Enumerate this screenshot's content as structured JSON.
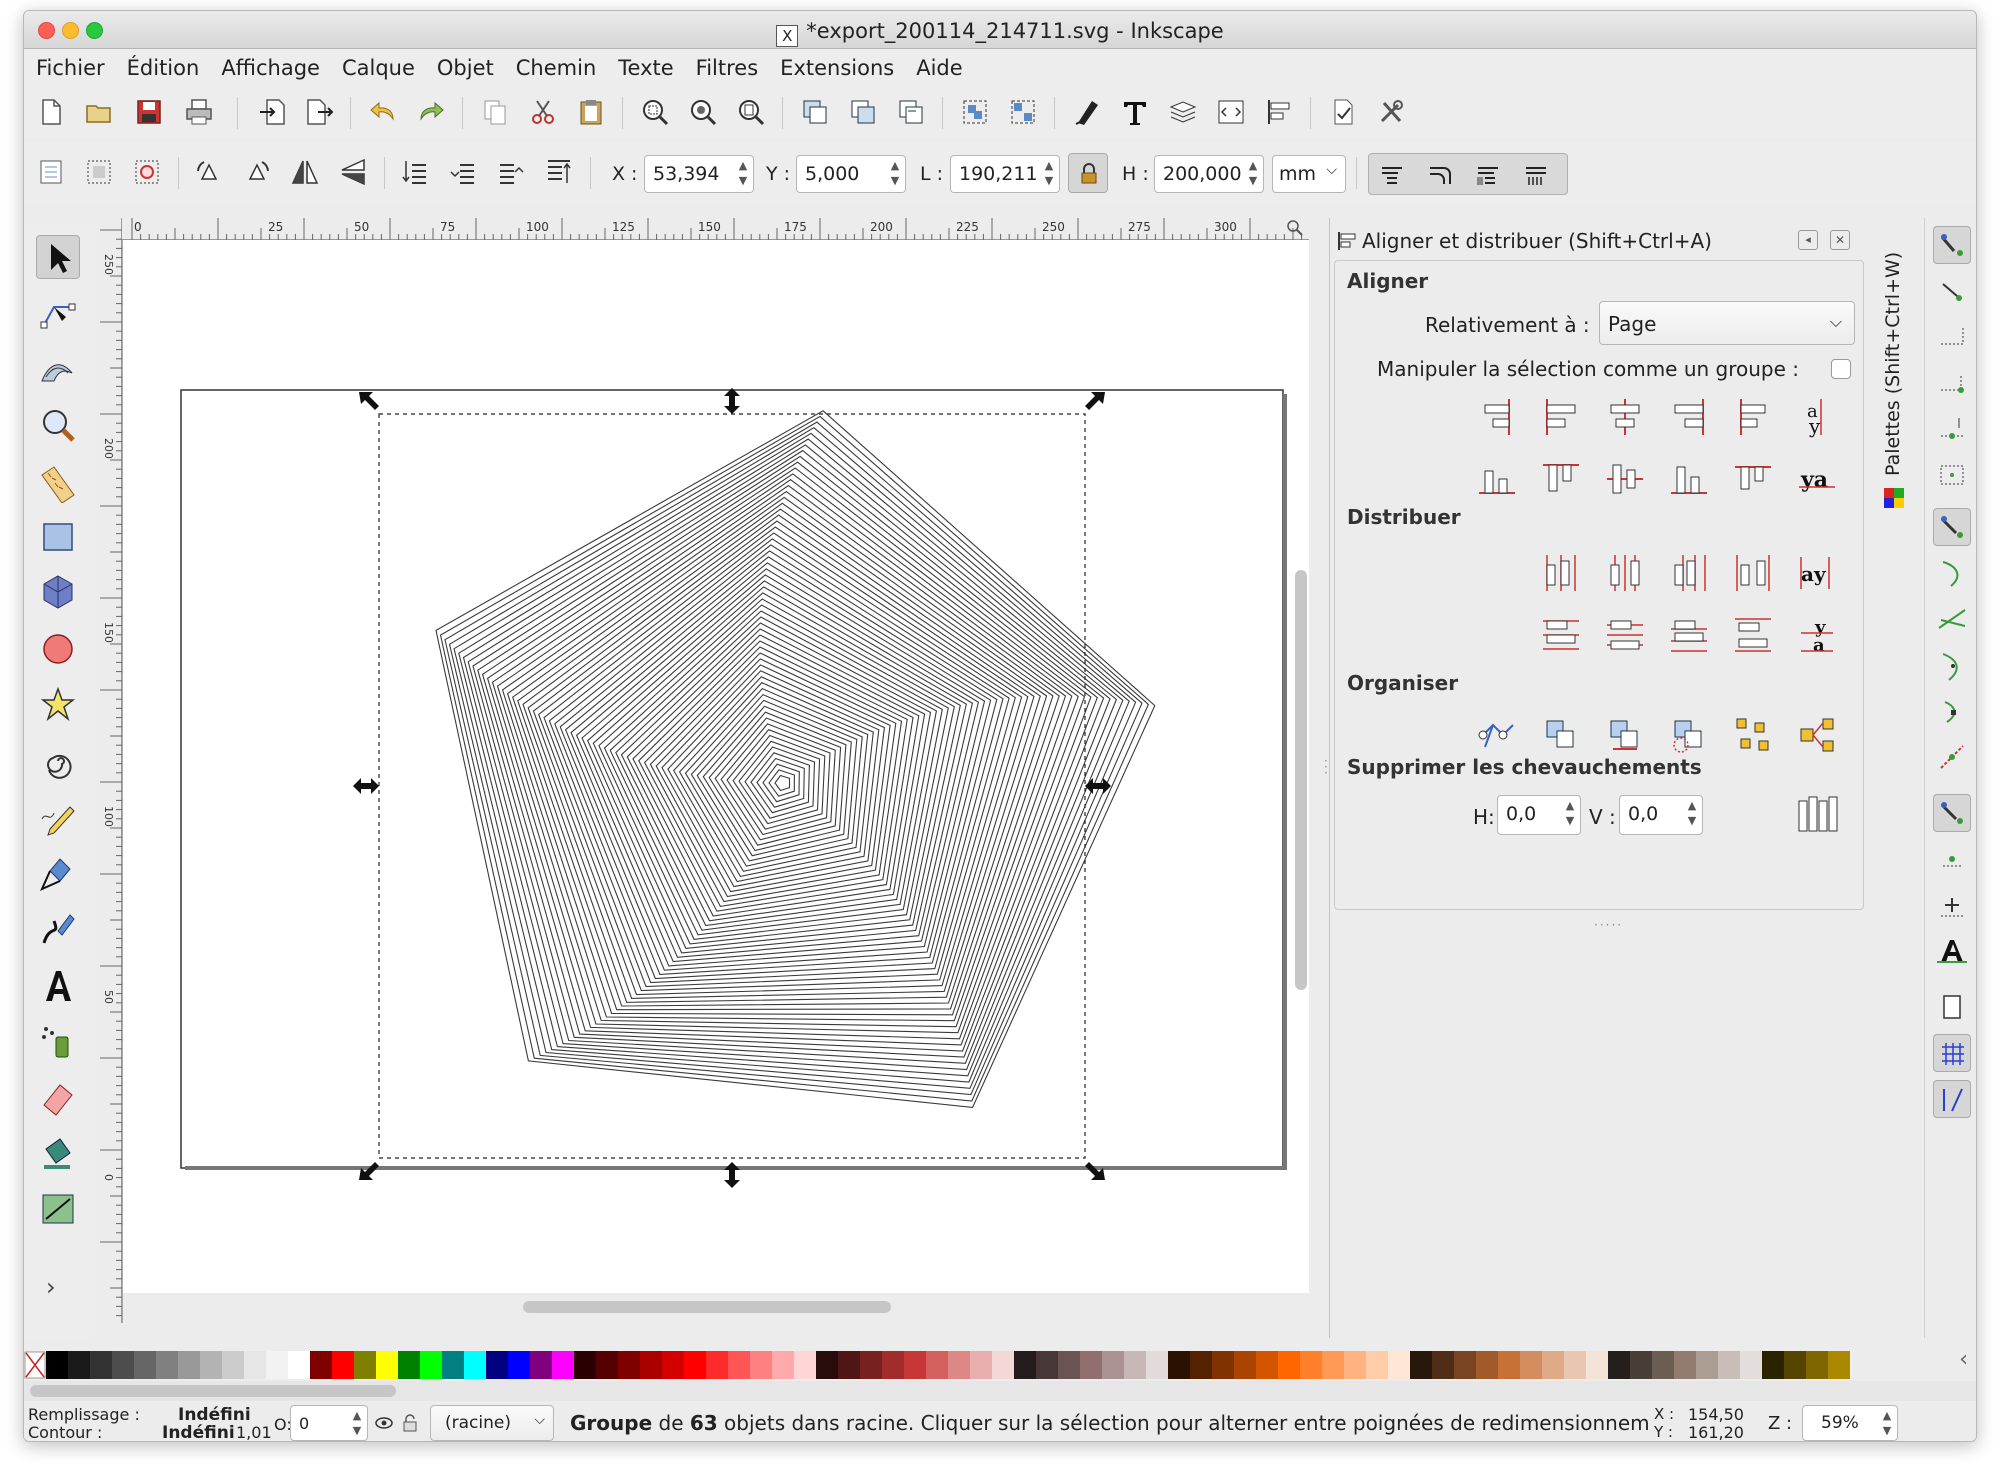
{
  "window": {
    "title": "*export_200114_214711.svg - Inkscape",
    "x11_glyph": "X"
  },
  "menu": [
    "Fichier",
    "Édition",
    "Affichage",
    "Calque",
    "Objet",
    "Chemin",
    "Texte",
    "Filtres",
    "Extensions",
    "Aide"
  ],
  "controls": {
    "x_label": "X :",
    "x_value": "53,394",
    "y_label": "Y :",
    "y_value": "5,000",
    "w_label": "L :",
    "w_value": "190,211",
    "h_label": "H :",
    "h_value": "200,000",
    "unit": "mm"
  },
  "ruler": {
    "h_ticks": [
      "0",
      "25",
      "50",
      "75",
      "100",
      "125",
      "150",
      "175",
      "200",
      "225",
      "250",
      "275",
      "300"
    ],
    "v_ticks": [
      "250",
      "200",
      "150",
      "100",
      "50",
      "0"
    ]
  },
  "align_panel": {
    "title": "Aligner et distribuer (Shift+Ctrl+A)",
    "section_align": "Aligner",
    "relative_label": "Relativement à :",
    "relative_value": "Page",
    "group_label": "Manipuler la sélection comme un groupe :",
    "section_distribute": "Distribuer",
    "section_arrange": "Organiser",
    "section_overlap": "Supprimer les chevauchements",
    "h_label": "H:",
    "h_value": "0,0",
    "v_label": "V :",
    "v_value": "0,0"
  },
  "palettes_tab": "Palettes (Shift+Ctrl+W)",
  "status": {
    "fill_label": "Remplissage :",
    "fill_value": "Indéfini",
    "stroke_label": "Contour :",
    "stroke_value": "Indéfini",
    "stroke_width": "1,01",
    "opacity_label": "O:",
    "opacity_value": "0",
    "layer": "(racine)",
    "message_prefix": "Groupe",
    "message_mid": " de ",
    "message_count": "63",
    "message_rest": " objets dans racine. Cliquer sur la sélection pour alterner entre poignées de redimensionnem",
    "x_label": "X :",
    "x_coord": "154,50",
    "y_label": "Y :",
    "y_coord": "161,20",
    "zoom_label": "Z :",
    "zoom": "59%"
  },
  "palette_colors": [
    "#000000",
    "#1a1a1a",
    "#333333",
    "#4d4d4d",
    "#666666",
    "#808080",
    "#999999",
    "#b3b3b3",
    "#cccccc",
    "#e6e6e6",
    "#f2f2f2",
    "#ffffff",
    "#800000",
    "#ff0000",
    "#808000",
    "#ffff00",
    "#008000",
    "#00ff00",
    "#008080",
    "#00ffff",
    "#000080",
    "#0000ff",
    "#800080",
    "#ff00ff",
    "#2b0000",
    "#550000",
    "#800000",
    "#aa0000",
    "#d40000",
    "#ff0000",
    "#ff2a2a",
    "#ff5555",
    "#ff8080",
    "#ffaaaa",
    "#ffd5d5",
    "#280b0b",
    "#501616",
    "#782121",
    "#a02c2c",
    "#c83737",
    "#d35f5f",
    "#de8787",
    "#e9afaf",
    "#f4d7d7",
    "#241c1c",
    "#483737",
    "#6c5353",
    "#916f6f",
    "#ac9393",
    "#c8b7b7",
    "#e3dbdb",
    "#2b1100",
    "#552200",
    "#803300",
    "#aa4400",
    "#d45500",
    "#ff6600",
    "#ff7f2a",
    "#ff9955",
    "#ffb380",
    "#ffccaa",
    "#ffe6d5",
    "#28170b",
    "#502d16",
    "#784421",
    "#a05a2c",
    "#c87137",
    "#d38d5f",
    "#deaa87",
    "#e9c6af",
    "#f4e3d7",
    "#241f1c",
    "#483e37",
    "#6c5d53",
    "#917c6f",
    "#ac9d93",
    "#c8beb7",
    "#e3dedb",
    "#2b2200",
    "#554400",
    "#806600",
    "#aa8800"
  ]
}
